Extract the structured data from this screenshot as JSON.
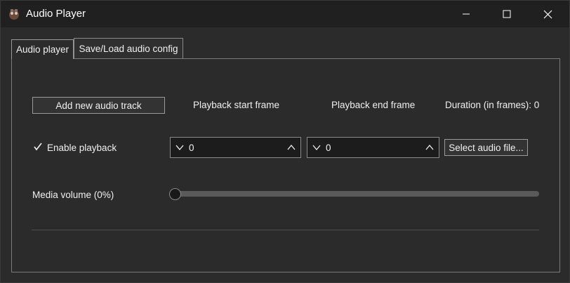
{
  "window": {
    "title": "Audio Player",
    "icons": {
      "app": "app-icon",
      "minimize": "minimize-icon",
      "maximize": "maximize-icon",
      "close": "close-icon"
    }
  },
  "tabs": [
    {
      "label": "Audio player",
      "active": true
    },
    {
      "label": "Save/Load audio config",
      "active": false
    }
  ],
  "header": {
    "add_track_label": "Add new audio track",
    "start_frame_label": "Playback start frame",
    "end_frame_label": "Playback end frame",
    "duration_label": "Duration (in frames): 0"
  },
  "track": {
    "enable_label": "Enable playback",
    "enabled": true,
    "start_value": "0",
    "end_value": "0",
    "select_file_label": "Select audio file..."
  },
  "volume": {
    "label": "Media volume (0%)",
    "level": 0
  },
  "colors": {
    "titlebar": "#202020",
    "background": "#2b2b2b",
    "text": "#f0f0f0"
  }
}
